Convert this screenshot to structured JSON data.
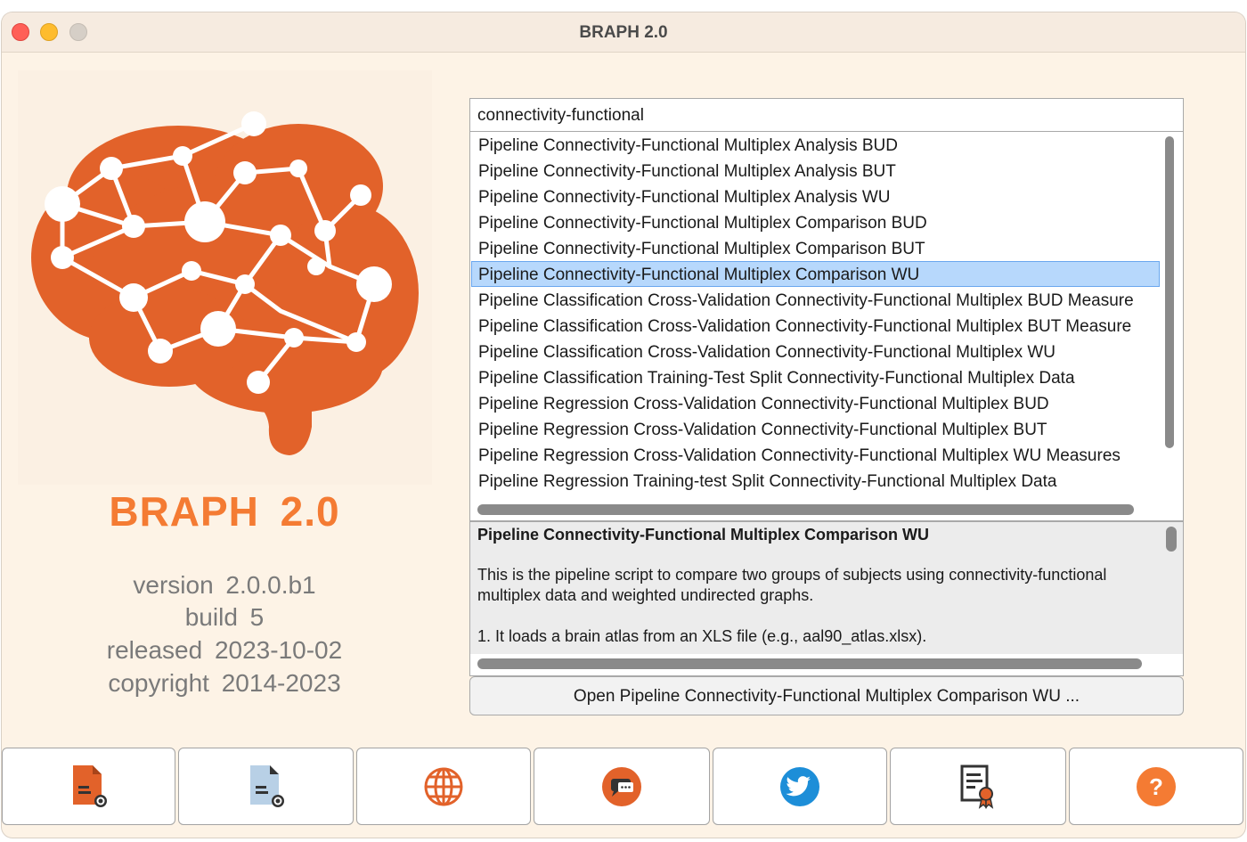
{
  "window": {
    "title": "BRAPH 2.0"
  },
  "brand": {
    "name": "BRAPH  2.0",
    "version": "version  2.0.0.b1",
    "build": "build  5",
    "released": "released  2023-10-02",
    "copyright": "copyright  2014-2023",
    "accent_color": "#f47b33",
    "logo_color": "#e2622a"
  },
  "search": {
    "value": "connectivity-functional"
  },
  "pipelines": {
    "items": [
      "Pipeline Connectivity-Functional Multiplex Analysis BUD",
      "Pipeline Connectivity-Functional Multiplex Analysis BUT",
      "Pipeline Connectivity-Functional Multiplex Analysis WU",
      "Pipeline Connectivity-Functional Multiplex Comparison BUD",
      "Pipeline Connectivity-Functional Multiplex Comparison BUT",
      "Pipeline Connectivity-Functional Multiplex Comparison WU",
      "Pipeline Classification Cross-Validation Connectivity-Functional Multiplex BUD Measure",
      "Pipeline Classification Cross-Validation Connectivity-Functional Multiplex BUT Measure",
      "Pipeline Classification Cross-Validation Connectivity-Functional Multiplex WU",
      "Pipeline Classification Training-Test Split Connectivity-Functional Multiplex Data",
      "Pipeline Regression Cross-Validation Connectivity-Functional Multiplex BUD",
      "Pipeline Regression Cross-Validation Connectivity-Functional Multiplex BUT",
      "Pipeline Regression Cross-Validation Connectivity-Functional Multiplex WU Measures",
      "Pipeline Regression Training-test Split Connectivity-Functional Multiplex Data"
    ],
    "selected_index": 5,
    "selection_color": "#b7d8fc"
  },
  "description": {
    "title": "Pipeline Connectivity-Functional Multiplex Comparison WU",
    "paragraph1": "This is the pipeline script to compare two groups of subjects using connectivity-functional multiplex data and weighted undirected graphs.",
    "paragraph2": "1. It loads a brain atlas from an XLS file (e.g., aal90_atlas.xlsx)."
  },
  "open_button": {
    "label": "Open Pipeline Connectivity-Functional Multiplex Comparison WU ..."
  },
  "toolbar": {
    "buttons": [
      {
        "icon": "new-file-orange-icon"
      },
      {
        "icon": "new-file-blue-icon"
      },
      {
        "icon": "globe-icon"
      },
      {
        "icon": "chat-icon"
      },
      {
        "icon": "twitter-icon"
      },
      {
        "icon": "license-icon"
      },
      {
        "icon": "help-icon"
      }
    ]
  }
}
